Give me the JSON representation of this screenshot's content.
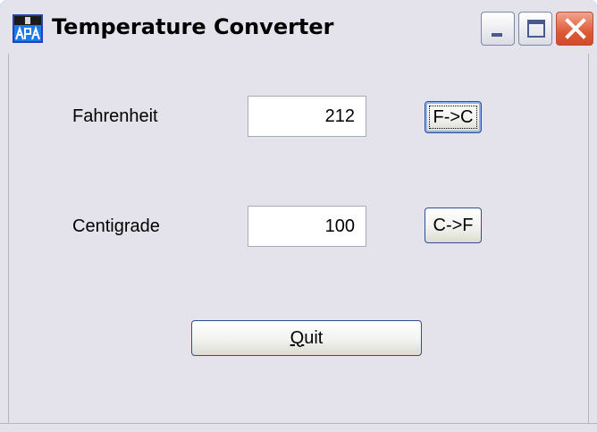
{
  "window": {
    "title": "Temperature Converter",
    "icon": "app-icon",
    "controls": {
      "minimize_icon": "minimize-icon",
      "maximize_icon": "maximize-icon",
      "close_icon": "close-icon"
    }
  },
  "form": {
    "fahrenheit": {
      "label": "Fahrenheit",
      "value": "212",
      "button_label": "F->C"
    },
    "centigrade": {
      "label": "Centigrade",
      "value": "100",
      "button_label": "C->F"
    },
    "quit": {
      "label_accel": "Q",
      "label_rest": "uit"
    }
  },
  "colors": {
    "face": "#e4e3ec",
    "close_button": "#de5a37",
    "button_border": "#2f4f8f"
  }
}
